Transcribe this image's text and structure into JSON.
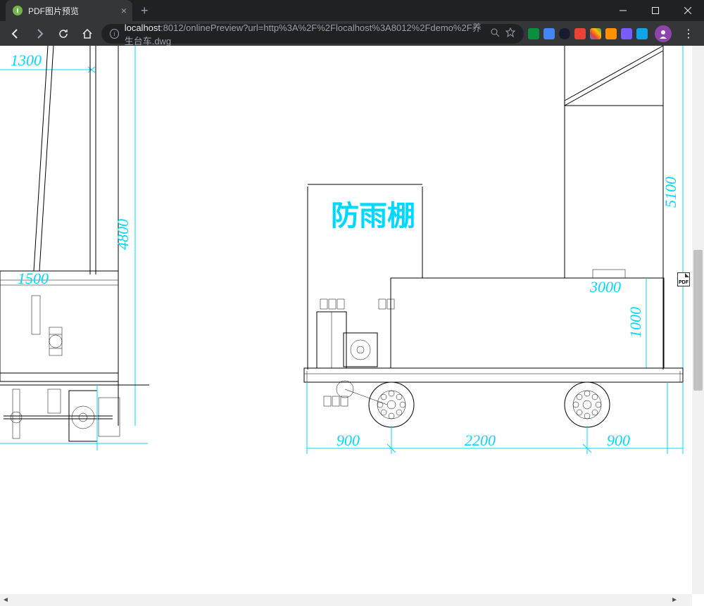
{
  "window": {
    "tab_title": "PDF图片预览",
    "url_host": "localhost",
    "url_path": ":8012/onlinePreview?url=http%3A%2F%2Flocalhost%3A8012%2Fdemo%2F养生台车.dwg"
  },
  "drawing": {
    "title_label": "防雨棚",
    "dimensions": {
      "top_left_1300": "1300",
      "left_1500": "1500",
      "left_4800": "4800",
      "right_3000": "3000",
      "right_1000": "1000",
      "right_5100": "5100",
      "bottom_900a": "900",
      "bottom_2200": "2200",
      "bottom_900b": "900"
    }
  },
  "badge": {
    "pdf": "PDF"
  }
}
